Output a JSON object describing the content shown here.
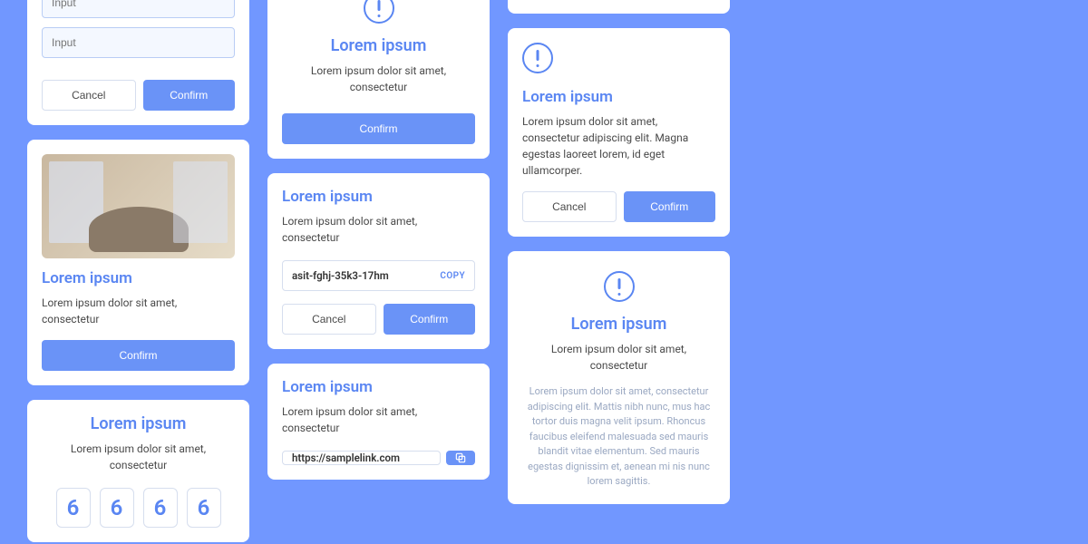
{
  "common": {
    "confirm": "Confirm",
    "cancel": "Cancel",
    "title": "Lorem ipsum",
    "body_short": "Lorem ipsum dolor sit amet, consectetur",
    "body_med": "Lorem ipsum dolor sit amet, consectetur adipiscing elit. Magna egestas laoreet lorem, id eget ullamcorper.",
    "body_long": "Lorem ipsum dolor sit amet, consectetur adipiscing elit. Mattis nibh nunc, mus hac tortor duis magna velit ipsum. Rhoncus faucibus eleifend malesuada sed mauris blandit vitae elementum. Sed mauris egestas dignissim et, aenean mi nis nunc lorem sagittis.",
    "input_placeholder": "Input",
    "copy_label": "COPY"
  },
  "card_copy": {
    "code": "asit-fghj-35k3-17hm"
  },
  "card_link": {
    "url": "https://samplelink.com"
  },
  "card_otp": {
    "d1": "6",
    "d2": "6",
    "d3": "6",
    "d4": "6"
  }
}
